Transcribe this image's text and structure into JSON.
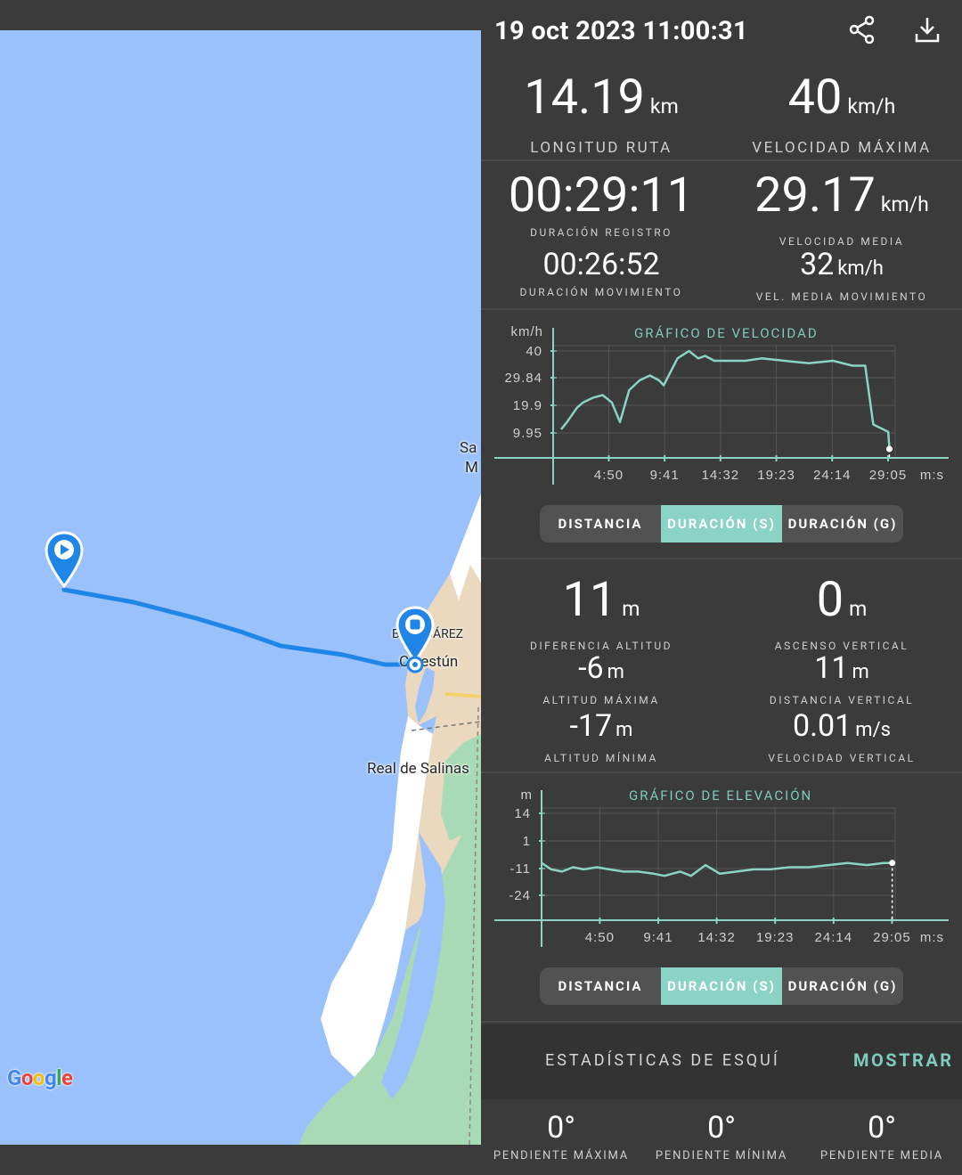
{
  "header": {
    "datetime": "19 oct 2023 11:00:31",
    "share_icon": "share-icon",
    "download_icon": "download-icon"
  },
  "map": {
    "labels": {
      "juarez": "B…J JUÁREZ",
      "celestun": "Celestún",
      "real_salinas": "Real de Salinas",
      "san_m_1": "Sa",
      "san_m_2": "M"
    },
    "google_logo": "Google",
    "start_icon": "play-pin-icon",
    "end_icon": "stop-pin-icon"
  },
  "summary": {
    "route_length": {
      "value": "14.19",
      "unit": "km",
      "label": "LONGITUD RUTA"
    },
    "max_speed": {
      "value": "40",
      "unit": "km/h",
      "label": "VELOCIDAD MÁXIMA"
    }
  },
  "times": {
    "record_duration": {
      "value": "00:29:11",
      "label": "DURACIÓN REGISTRO"
    },
    "avg_speed": {
      "value": "29.17",
      "unit": "km/h",
      "label": "VELOCIDAD MEDIA"
    },
    "moving_duration": {
      "value": "00:26:52",
      "label": "DURACIÓN MOVIMIENTO"
    },
    "avg_moving_speed": {
      "value": "32",
      "unit": "km/h",
      "label": "VEL. MEDIA MOVIMIENTO"
    }
  },
  "speed_chart": {
    "title": "GRÁFICO DE VELOCIDAD",
    "y_unit": "km/h",
    "x_unit": "m:s",
    "y_ticks": [
      "40",
      "29.84",
      "19.9",
      "9.95"
    ],
    "x_ticks": [
      "4:50",
      "9:41",
      "14:32",
      "19:23",
      "24:14",
      "29:05"
    ]
  },
  "speed_segments": {
    "distance": "DISTANCIA",
    "duration_s": "DURACIÓN (S)",
    "duration_g": "DURACIÓN (G)",
    "active": "duration_s"
  },
  "altitude": {
    "diff": {
      "value": "11",
      "unit": "m",
      "label": "DIFERENCIA ALTITUD"
    },
    "ascent": {
      "value": "0",
      "unit": "m",
      "label": "ASCENSO VERTICAL"
    },
    "max": {
      "value": "-6",
      "unit": "m",
      "label": "ALTITUD MÁXIMA"
    },
    "vdist": {
      "value": "11",
      "unit": "m",
      "label": "DISTANCIA VERTICAL"
    },
    "min": {
      "value": "-17",
      "unit": "m",
      "label": "ALTITUD MÍNIMA"
    },
    "vspeed": {
      "value": "0.01",
      "unit": "m/s",
      "label": "VELOCIDAD VERTICAL"
    }
  },
  "elevation_chart": {
    "title": "GRÁFICO DE ELEVACIÓN",
    "y_unit": "m",
    "x_unit": "m:s",
    "y_ticks": [
      "14",
      "1",
      "-11",
      "-24"
    ],
    "x_ticks": [
      "4:50",
      "9:41",
      "14:32",
      "19:23",
      "24:14",
      "29:05"
    ]
  },
  "elevation_segments": {
    "distance": "DISTANCIA",
    "duration_s": "DURACIÓN (S)",
    "duration_g": "DURACIÓN (G)",
    "active": "duration_s"
  },
  "ski": {
    "label": "ESTADÍSTICAS DE ESQUÍ",
    "button": "MOSTRAR"
  },
  "slope": {
    "max": {
      "value": "0°",
      "label": "PENDIENTE MÁXIMA"
    },
    "min": {
      "value": "0°",
      "label": "PENDIENTE MÍNIMA"
    },
    "avg": {
      "value": "0°",
      "label": "PENDIENTE MEDIA"
    }
  },
  "chart_data": [
    {
      "type": "line",
      "title": "GRÁFICO DE VELOCIDAD",
      "ylabel": "km/h",
      "xlabel": "m:s",
      "ylim": [
        0,
        40
      ],
      "x_ticks": [
        "4:50",
        "9:41",
        "14:32",
        "19:23",
        "24:14",
        "29:05"
      ],
      "series": [
        {
          "x_minutes": [
            0.7,
            1.2,
            2.1,
            2.6,
            3.5,
            4.3,
            5.1,
            5.8,
            6.6,
            7.5,
            8.4,
            9.2,
            9.6,
            10.8,
            11.8,
            12.6,
            13.2,
            14.0,
            15.1,
            16.7,
            18.1,
            20.1,
            22.2,
            24.3,
            26.0,
            27.1,
            27.8,
            29.1,
            29.2
          ],
          "values": [
            8,
            11,
            17,
            19,
            21,
            22,
            19,
            11,
            24,
            28,
            30,
            28,
            26,
            37,
            40,
            37,
            38,
            36,
            36,
            36,
            37,
            36,
            35,
            36,
            34,
            34,
            10,
            7,
            0
          ]
        }
      ]
    },
    {
      "type": "line",
      "title": "GRÁFICO DE ELEVACIÓN",
      "ylabel": "m",
      "xlabel": "m:s",
      "ylim": [
        -24,
        14
      ],
      "x_ticks": [
        "4:50",
        "9:41",
        "14:32",
        "19:23",
        "24:14",
        "29:05"
      ],
      "series": [
        {
          "x_minutes": [
            0.0,
            0.8,
            1.7,
            2.6,
            3.5,
            4.6,
            5.6,
            6.8,
            8.0,
            9.3,
            10.2,
            11.5,
            12.4,
            13.6,
            14.8,
            16.2,
            17.6,
            19.0,
            20.6,
            22.2,
            23.8,
            25.4,
            27.0,
            28.4,
            29.1
          ],
          "values": [
            -9,
            -12,
            -13,
            -11,
            -12,
            -11,
            -12,
            -13,
            -13,
            -14,
            -15,
            -13,
            -15,
            -10,
            -14,
            -13,
            -12,
            -12,
            -11,
            -11,
            -10,
            -9,
            -10,
            -9,
            -9
          ]
        }
      ]
    }
  ]
}
